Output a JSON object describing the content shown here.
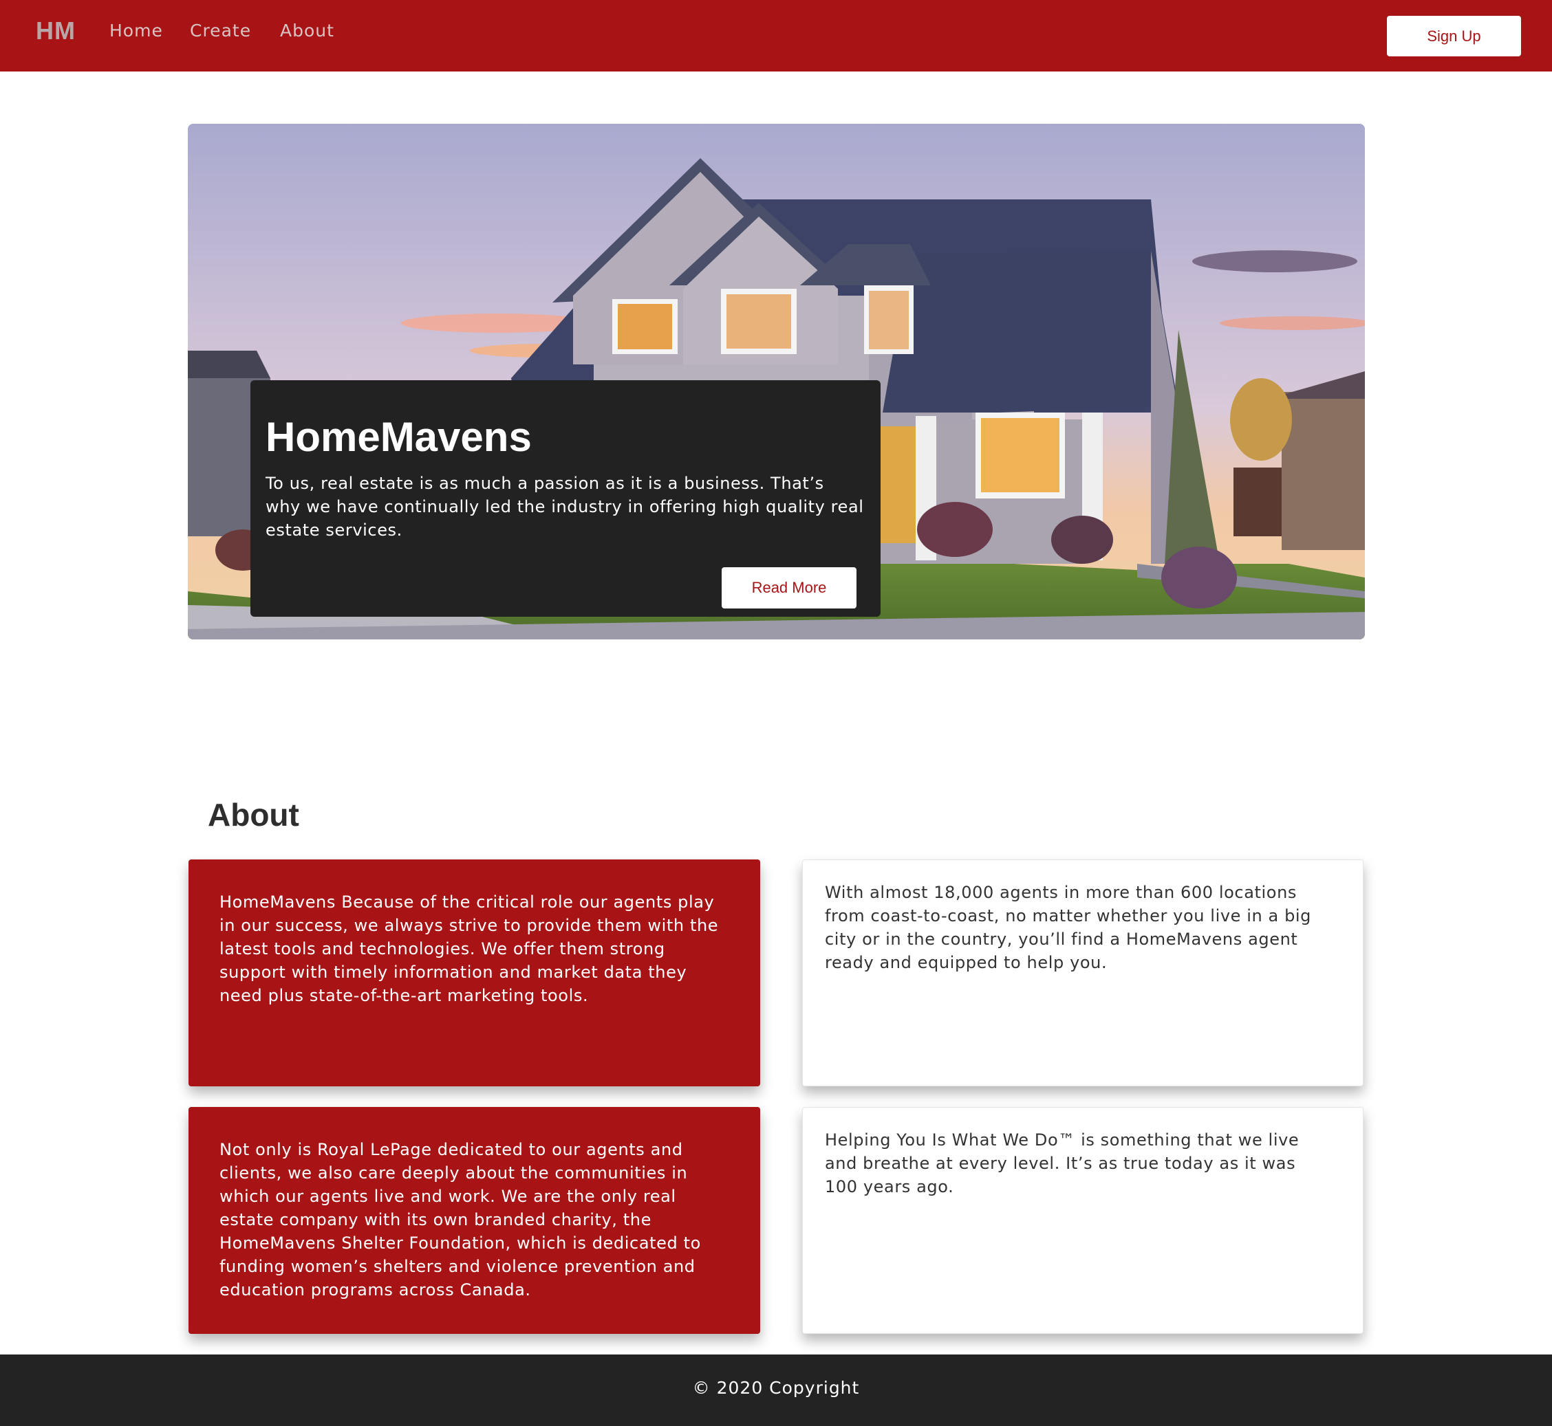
{
  "navbar": {
    "brand": "HM",
    "links": [
      "Home",
      "Create",
      "About"
    ],
    "signup_label": "Sign Up"
  },
  "hero": {
    "title": "HomeMavens",
    "text": "To us, real estate is as much a passion as it is a business. That’s why we have continually led the industry in offering high quality real estate services.",
    "button_label": "Read More",
    "image": "house-at-sunset"
  },
  "about": {
    "heading": "About",
    "cards": [
      "HomeMavens Because of the critical role our agents play in our success, we always strive to provide them with the latest tools and technologies. We offer them strong support with timely information and market data they need plus state-of-the-art marketing tools.",
      "With almost 18,000 agents in more than 600 locations from coast-to-coast, no matter whether you live in a big city or in the country, you’ll find a HomeMavens agent ready and equipped to help you.",
      "Not only is Royal LePage dedicated to our agents and clients, we also care deeply about the communities in which our agents live and work. We are the only real estate company with its own branded charity, the HomeMavens Shelter Foundation, which is dedicated to funding women’s shelters and violence prevention and education programs across Canada.",
      "Helping You Is What We Do™ is something that we live and breathe at every level. It’s as true today as it was 100 years ago."
    ]
  },
  "footer": {
    "text": "© 2020 Copyright"
  },
  "colors": {
    "brand_red": "#a81415",
    "dark": "#222222",
    "white": "#ffffff"
  }
}
